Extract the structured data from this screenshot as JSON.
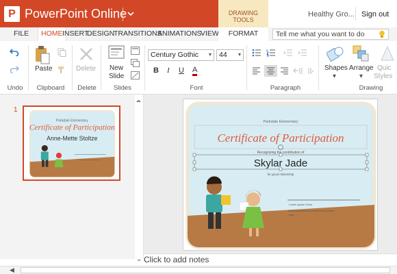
{
  "titlebar": {
    "logo_letter": "P",
    "app_name": "PowerPoint Online",
    "contextual_tab": "DRAWING TOOLS",
    "user_name": "Healthy Gro...",
    "sign_out": "Sign out"
  },
  "tabs": [
    "FILE",
    "HOME",
    "INSERT",
    "DESIGN",
    "TRANSITIONS",
    "ANIMATIONS",
    "VIEW"
  ],
  "format_tab": "FORMAT",
  "tell_me": {
    "placeholder": "Tell me what you want to do"
  },
  "ribbon": {
    "groups": {
      "undo": "Undo",
      "clipboard": "Clipboard",
      "delete": "Delete",
      "slides": "Slides",
      "font": "Font",
      "paragraph": "Paragraph",
      "drawing": "Drawing"
    },
    "buttons": {
      "paste": "Paste",
      "delete": "Delete",
      "new_slide_1": "New",
      "new_slide_2": "Slide",
      "shapes": "Shapes",
      "arrange": "Arrange",
      "quick_styles_1": "Quic",
      "quick_styles_2": "Styles"
    },
    "font_name": "Century Gothic",
    "font_size": "44",
    "bold": "B",
    "italic": "I",
    "underline": "U",
    "font_color": "A"
  },
  "slide_panel": {
    "slide_number": "1",
    "thumb_school": "Parkdale Elementary",
    "thumb_title": "Certificate of Participation",
    "thumb_recipient": "Anne-Mette Stoltze"
  },
  "slide": {
    "school": "Parkdale Elementary",
    "title": "Certificate of Participation",
    "subtitle": "Recognizing the contribution of",
    "recipient": "Skylar Jade",
    "reason": "for good citizenship",
    "sig_label": "Lorem Ipsum Dolor",
    "date_label": "date"
  },
  "notes": "Click to add notes",
  "colors": {
    "accent": "#d24726",
    "drawing_tools": "#f7e8bf",
    "slide_bg": "#d8edf3",
    "slide_border": "#f5f0e6",
    "ground": "#b87a44",
    "title_script": "#e05a3a"
  }
}
